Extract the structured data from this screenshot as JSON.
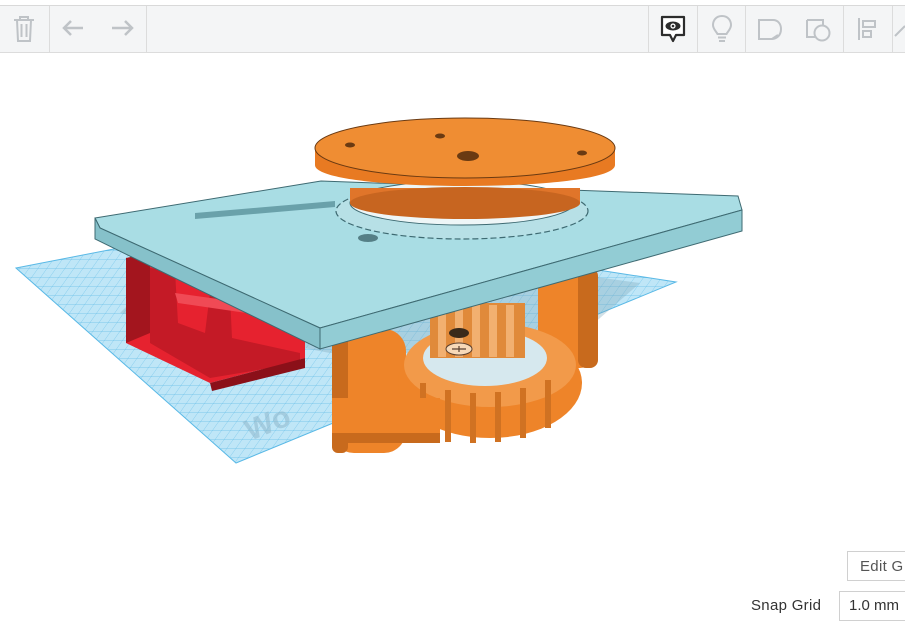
{
  "toolbar": {
    "left_tools": [
      {
        "name": "delete",
        "icon": "trash-icon"
      },
      {
        "name": "undo",
        "icon": "undo-arrow-icon"
      },
      {
        "name": "redo",
        "icon": "redo-arrow-icon"
      }
    ],
    "right_tools": [
      {
        "name": "notes",
        "icon": "eye-speech-bubble-icon",
        "active": true
      },
      {
        "name": "hint",
        "icon": "lightbulb-icon"
      },
      {
        "name": "shape-solid",
        "icon": "solid-shape-icon"
      },
      {
        "name": "shape-hole",
        "icon": "hole-shape-icon"
      },
      {
        "name": "align",
        "icon": "align-icon"
      }
    ]
  },
  "viewport": {
    "workplane_label": "Wo",
    "edit_grid_label": "Edit G",
    "snap_grid_label": "Snap Grid",
    "snap_grid_value": "1.0 mm"
  },
  "colors": {
    "toolbar_bg": "#f4f5f6",
    "icon_gray": "#bfc3c7",
    "icon_active": "#3a3a3a",
    "workplane_blue": "#6cc6ee",
    "plate_blue": "#a9dde4",
    "orange": "#ee8429",
    "red": "#e32030"
  }
}
